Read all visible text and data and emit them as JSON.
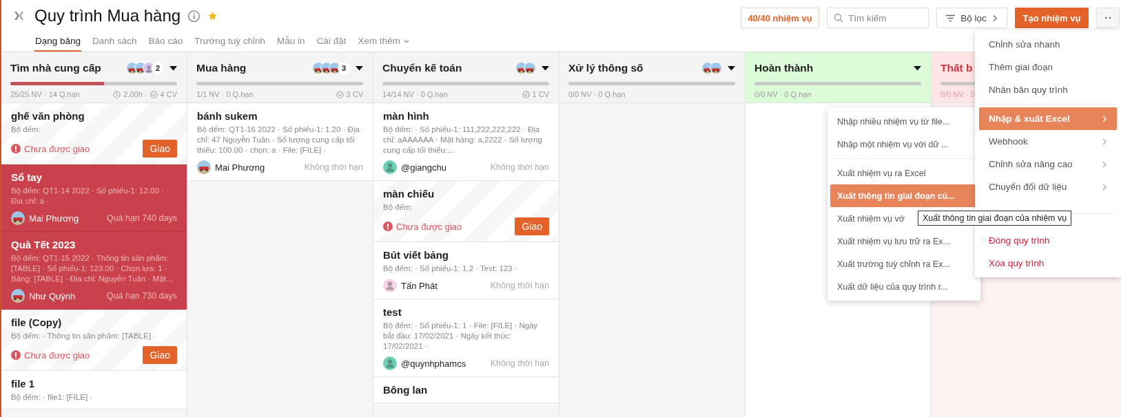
{
  "header": {
    "title": "Quy trình Mua hàng",
    "starred": true,
    "tabs": [
      {
        "label": "Dạng bảng",
        "selected": true,
        "kind": "tab"
      },
      {
        "label": "Danh sách",
        "selected": false,
        "kind": "tab"
      },
      {
        "label": "Báo cáo",
        "selected": false,
        "kind": "tab"
      },
      {
        "label": "Trường tuỳ chỉnh",
        "selected": false,
        "kind": "tab"
      },
      {
        "label": "Mẫu in",
        "selected": false,
        "kind": "tab"
      },
      {
        "label": "Cài đặt",
        "selected": false,
        "kind": "tab"
      },
      {
        "label": "Xem thêm",
        "selected": false,
        "kind": "dropdown"
      }
    ],
    "task_count": "40/40 nhiệm vụ",
    "search": {
      "placeholder": "Tìm kiếm"
    },
    "filter_button": "Bộ lọc",
    "create_button": "Tạo nhiệm vụ"
  },
  "columns": [
    {
      "title": "Tìm nhà cung cấp",
      "kind": "default",
      "dropdown": true,
      "members": [
        {
          "kind": "photo"
        },
        {
          "kind": "photo"
        },
        {
          "kind": "user",
          "color": "#d9c4ec"
        }
      ],
      "member_count": "2",
      "level": 0.56,
      "stats": "25/25 NV · 14 Q.hạn",
      "time": "2.00h ·",
      "done": "4 CV",
      "cards": [
        {
          "title": "ghế văn phòng",
          "kind": "unassigned",
          "overdue": false,
          "details": "Bộ đếm:",
          "status": "Chưa được giao",
          "button": "Giao"
        },
        {
          "title": "Sổ tay",
          "kind": "assigned",
          "overdue": true,
          "details": "Bộ đếm: QT1-14 2022 · Số phiếu-1: 12.00 · Địa chỉ: a ·",
          "assignee": "Mai Phương",
          "avatar": {
            "kind": "photo"
          },
          "due": "Quá hạn 740 days"
        },
        {
          "title": "Quà Tết 2023",
          "kind": "assigned",
          "overdue": true,
          "details": "Bộ đếm: QT1-15 2022 · Thông tin sản phẩm: [TABLE] · Số phiếu-1: 123.00 · Chọn lựa: 1 · Bảng: [TABLE] · Địa chỉ: Nguyễn Tuân · Mặt...",
          "assignee": "Như Quỳnh",
          "avatar": {
            "kind": "photo"
          },
          "due": "Quá hạn 730 days"
        },
        {
          "title": "file (Copy)",
          "kind": "unassigned",
          "overdue": false,
          "details": "Bộ đếm: · Thông tin sản phẩm: [TABLE] ·",
          "status": "Chưa được giao",
          "button": "Giao"
        },
        {
          "title": "file 1",
          "kind": "assigned",
          "overdue": false,
          "details": "Bộ đếm: · file1: [FILE] ·"
        }
      ]
    },
    {
      "title": "Mua hàng",
      "kind": "default",
      "dropdown": true,
      "members": [
        {
          "kind": "photo"
        },
        {
          "kind": "photo"
        },
        {
          "kind": "photo"
        }
      ],
      "member_count": "3",
      "stats": "1/1 NV · 0 Q.hạn",
      "done": "3 CV",
      "cards": [
        {
          "title": "bánh sukem",
          "kind": "assigned",
          "overdue": false,
          "details": "Bộ đếm: QT1-16 2022 · Số phiếu-1: 1.20 · Địa chỉ: 47 Nguyễn Tuân · Số lượng cung cấp tối thiểu: 100.00 · chọn: a · File: [FILE] ·",
          "assignee": "Mai Phương",
          "avatar": {
            "kind": "photo"
          },
          "due": "Không thời hạn"
        }
      ]
    },
    {
      "title": "Chuyển kế toán",
      "kind": "default",
      "dropdown": true,
      "members": [
        {
          "kind": "photo"
        },
        {
          "kind": "photo"
        }
      ],
      "stats": "14/14 NV · 0 Q.hạn",
      "done": "1 CV",
      "cards": [
        {
          "title": "màn hình",
          "kind": "assigned",
          "overdue": false,
          "details": "Bộ đếm: · Số phiếu-1: 111,222,222,222 · Địa chỉ: aAAAAAA · Mặt hàng: a,2222 · Số lượng cung cấp tối thiểu:...",
          "assignee": "@giangchu",
          "avatar": {
            "kind": "user",
            "color": "#6fcfb4"
          },
          "due": "Không thời hạn"
        },
        {
          "title": "màn chiếu",
          "kind": "unassigned",
          "overdue": false,
          "details": "Bộ đếm:",
          "status": "Chưa được giao",
          "button": "Giao"
        },
        {
          "title": "Bút viết bảng",
          "kind": "assigned",
          "overdue": false,
          "details": "Bộ đếm: · Số phiếu-1: 1.2 · Test: 123 ·",
          "assignee": "Tấn Phát",
          "avatar": {
            "kind": "user",
            "color": "#f6d6e6"
          },
          "due": "Không thời hạn"
        },
        {
          "title": "test",
          "kind": "assigned",
          "overdue": false,
          "details": "Bộ đếm: · Số phiếu-1: 1 · File: [FILE] · Ngày bắt đầu: 17/02/2021 · Ngày kết thúc: 17/02/2021 ·",
          "assignee": "@quynhphamcs",
          "avatar": {
            "kind": "user",
            "color": "#6fcfb4"
          },
          "due": "Không thời hạn"
        },
        {
          "title": "Bông lan",
          "kind": "assigned",
          "overdue": false
        }
      ]
    },
    {
      "title": "Xử lý thông số",
      "kind": "default",
      "dropdown": true,
      "members": [
        {
          "kind": "photo"
        },
        {
          "kind": "photo"
        }
      ],
      "stats": "0/0 NV · 0 Q.hạn"
    },
    {
      "title": "Hoàn thành",
      "kind": "success",
      "dropdown": true,
      "stats": "0/0 NV · 0 Q.hạn"
    },
    {
      "title": "Thất b",
      "kind": "failure",
      "stats": "0/0 NV · 0"
    }
  ],
  "submenu": {
    "groups": [
      [
        {
          "label": "Nhập nhiều nhiệm vụ từ file...",
          "kind": "plain",
          "selected": false
        },
        {
          "label": "Nhập một nhiệm vụ với dữ ...",
          "kind": "plain",
          "selected": false
        }
      ],
      [
        {
          "label": "Xuất nhiệm vụ ra Excel",
          "kind": "plain",
          "selected": false
        },
        {
          "label": "Xuất thông tin giai đoạn củ...",
          "kind": "plain",
          "selected": true
        },
        {
          "label": "Xuất nhiệm vụ vớ",
          "kind": "plain",
          "selected": false
        },
        {
          "label": "Xuất nhiệm vụ lưu trữ ra Ex...",
          "kind": "plain",
          "selected": false
        },
        {
          "label": "Xuất trường tuỳ chỉnh ra Ex...",
          "kind": "plain",
          "selected": false
        },
        {
          "label": "Xuất dữ liệu của quy trình r...",
          "kind": "plain",
          "selected": false
        }
      ]
    ]
  },
  "menu": {
    "groups": [
      [
        {
          "label": "Chỉnh sửa nhanh",
          "kind": "plain",
          "selected": false
        },
        {
          "label": "Thêm giai đoạn",
          "kind": "plain",
          "selected": false
        },
        {
          "label": "Nhân bản quy trình",
          "kind": "plain",
          "selected": false
        }
      ],
      [
        {
          "label": "Nhập & xuất Excel",
          "kind": "submenu",
          "selected": true
        },
        {
          "label": "Webhook",
          "kind": "submenu",
          "selected": false
        },
        {
          "label": "Chỉnh sửa nâng cao",
          "kind": "submenu",
          "selected": false
        },
        {
          "label": "Chuyển đổi dữ liệu",
          "kind": "submenu",
          "selected": false
        }
      ],
      [
        {
          "label": "Đóng quy trình",
          "kind": "danger",
          "selected": false
        },
        {
          "label": "Xóa quy trình",
          "kind": "danger",
          "selected": false
        }
      ]
    ]
  },
  "tooltip": {
    "text": "Xuất thông tin giai đoạn của nhiệm vụ"
  }
}
